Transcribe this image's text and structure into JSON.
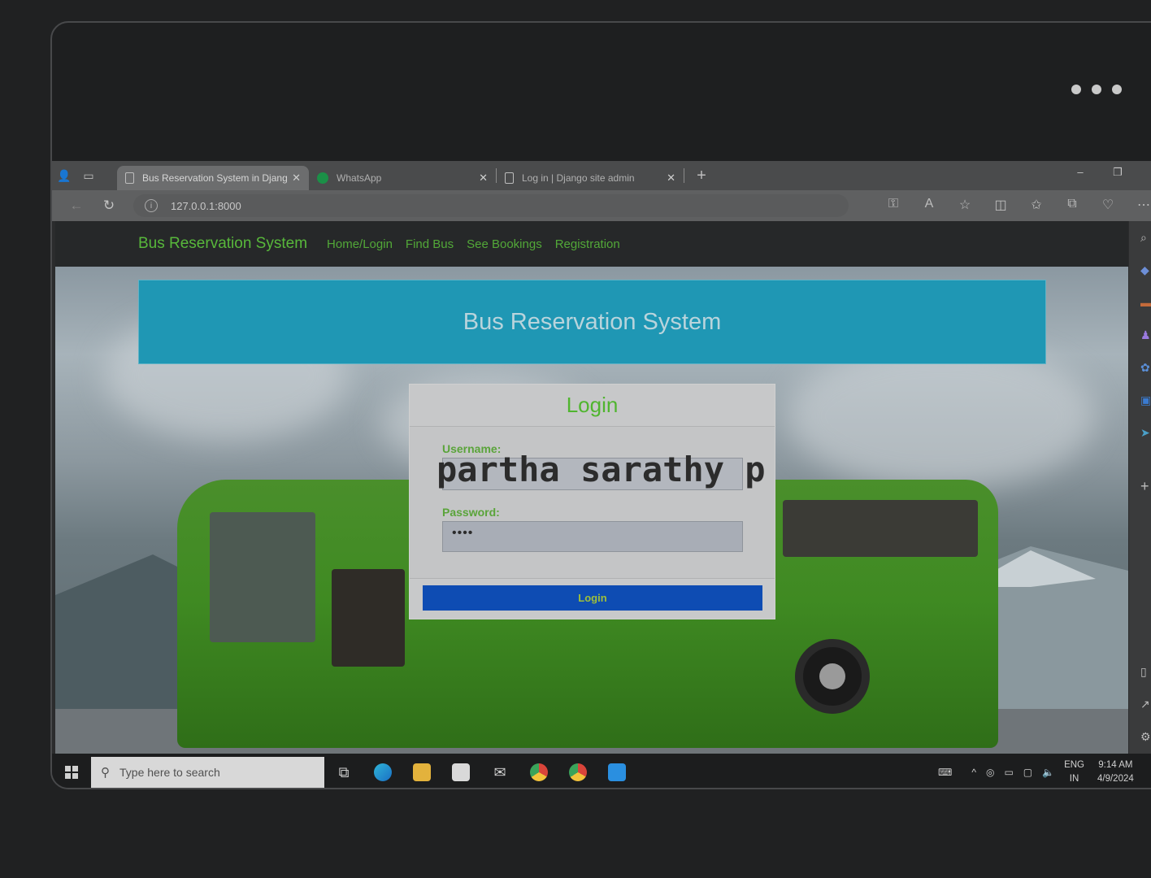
{
  "browser": {
    "tabs": [
      {
        "label": "Bus Reservation System in Djang",
        "icon": "document-icon",
        "active": true
      },
      {
        "label": "WhatsApp",
        "icon": "whatsapp-icon",
        "active": false
      },
      {
        "label": "Log in | Django site admin",
        "icon": "document-icon",
        "active": false
      }
    ],
    "new_tab": "+",
    "url": "127.0.0.1:8000",
    "window_controls": {
      "minimize": "–",
      "restore": "❐",
      "close": "✕"
    }
  },
  "site": {
    "brand": "Bus Reservation System",
    "nav": [
      "Home/Login",
      "Find Bus",
      "See Bookings",
      "Registration"
    ],
    "banner_title": "Bus Reservation System",
    "login": {
      "title": "Login",
      "username_label": "Username:",
      "username_value": "partha sarathy p",
      "password_label": "Password:",
      "password_mask": "••••",
      "button": "Login"
    }
  },
  "taskbar": {
    "search_placeholder": "Type here to search",
    "lang_top": "ENG",
    "lang_bottom": "IN",
    "time": "9:14 AM",
    "date": "4/9/2024"
  },
  "colors": {
    "brand_green": "#58b83b",
    "banner": "#1f97b4",
    "login_button": "#0e4cb3"
  }
}
